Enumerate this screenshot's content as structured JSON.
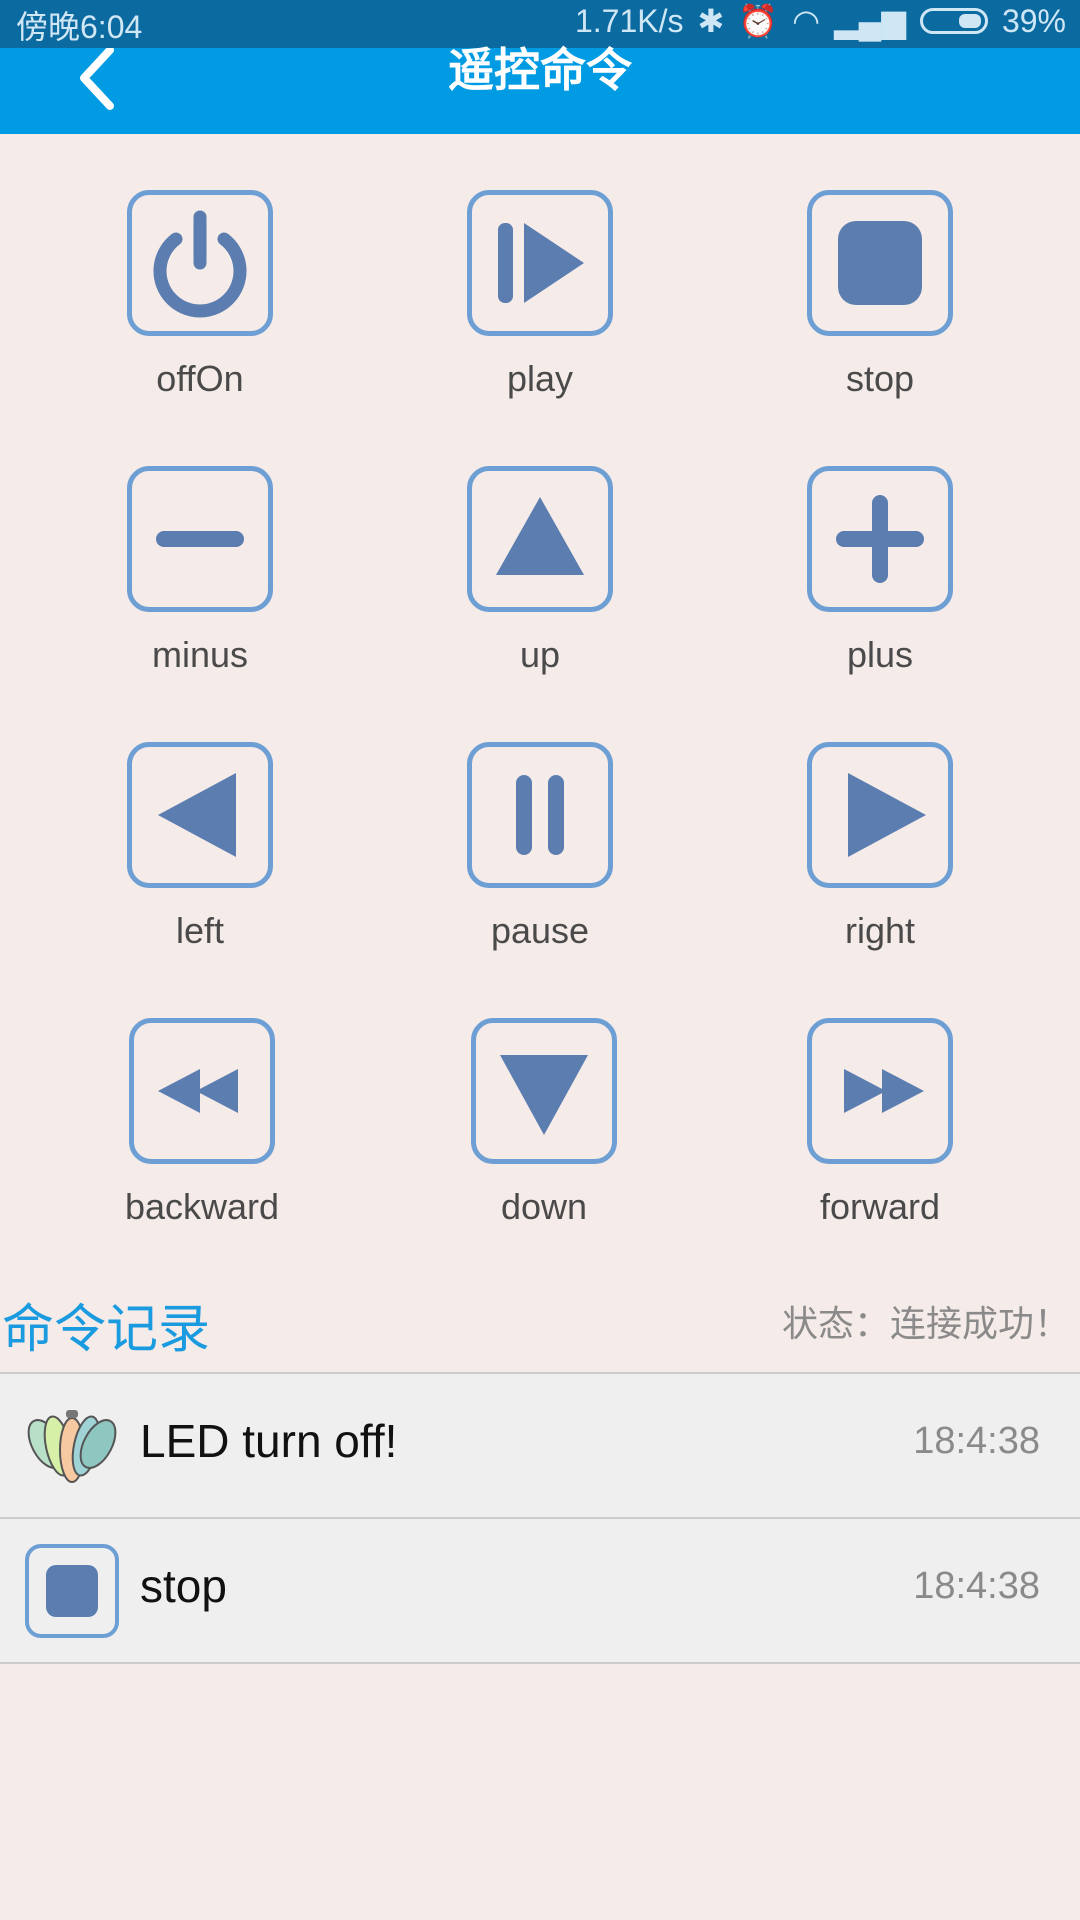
{
  "status_bar": {
    "time": "傍晚6:04",
    "speed": "1.71K/s",
    "battery": "39%"
  },
  "header": {
    "title": "遥控命令",
    "back_icon": "chevron-left-icon"
  },
  "colors": {
    "status_bar": "#0b6aa0",
    "title_bar": "#009be3",
    "background": "#f5ebe8",
    "icon_border": "#6d9fd4",
    "icon_fill": "#5b7db0",
    "accent_text": "#1a9be0"
  },
  "commands": [
    {
      "label": "offOn",
      "icon": "power-icon"
    },
    {
      "label": "play",
      "icon": "play-icon"
    },
    {
      "label": "stop",
      "icon": "stop-icon"
    },
    {
      "label": "minus",
      "icon": "minus-icon"
    },
    {
      "label": "up",
      "icon": "triangle-up-icon"
    },
    {
      "label": "plus",
      "icon": "plus-icon"
    },
    {
      "label": "left",
      "icon": "triangle-left-icon"
    },
    {
      "label": "pause",
      "icon": "pause-icon"
    },
    {
      "label": "right",
      "icon": "triangle-right-icon"
    },
    {
      "label": "backward",
      "icon": "rewind-icon"
    },
    {
      "label": "down",
      "icon": "triangle-down-icon"
    },
    {
      "label": "forward",
      "icon": "fast-forward-icon"
    }
  ],
  "log": {
    "title": "命令记录",
    "status": "状态：连接成功！",
    "entries": [
      {
        "text": "LED turn off!",
        "time": "18:4:38",
        "icon": "shell-lamp-icon"
      },
      {
        "text": "stop",
        "time": "18:4:38",
        "icon": "stop-icon"
      }
    ]
  }
}
